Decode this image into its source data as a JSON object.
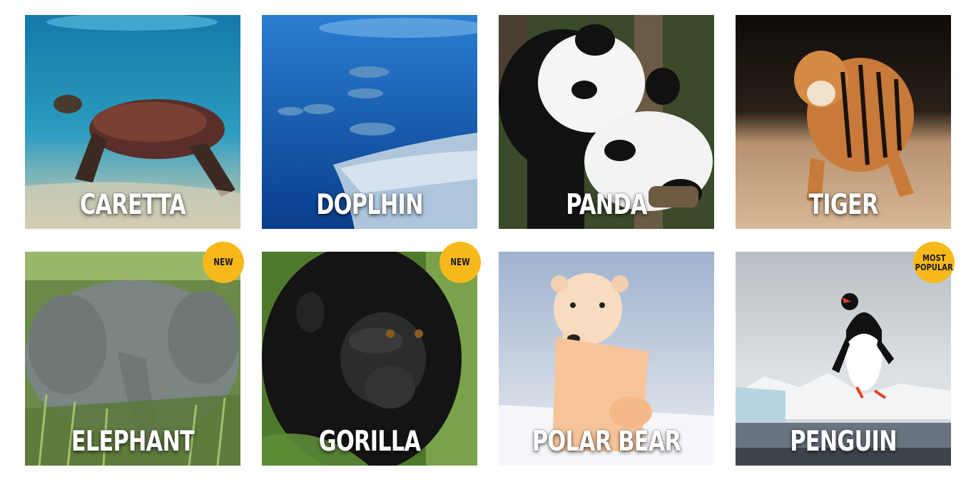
{
  "cards": [
    {
      "name": "CARETTA",
      "badge": ""
    },
    {
      "name": "DOPLHIN",
      "badge": ""
    },
    {
      "name": "PANDA",
      "badge": ""
    },
    {
      "name": "TIGER",
      "badge": ""
    },
    {
      "name": "ELEPHANT",
      "badge": "NEW"
    },
    {
      "name": "GORILLA",
      "badge": "NEW"
    },
    {
      "name": "POLAR BEAR",
      "badge": ""
    },
    {
      "name": "PENGUIN",
      "badge_line1": "MOST",
      "badge_line2": "POPULAR"
    }
  ],
  "colors": {
    "badge": "#f7b81a",
    "label": "#ffffff"
  }
}
